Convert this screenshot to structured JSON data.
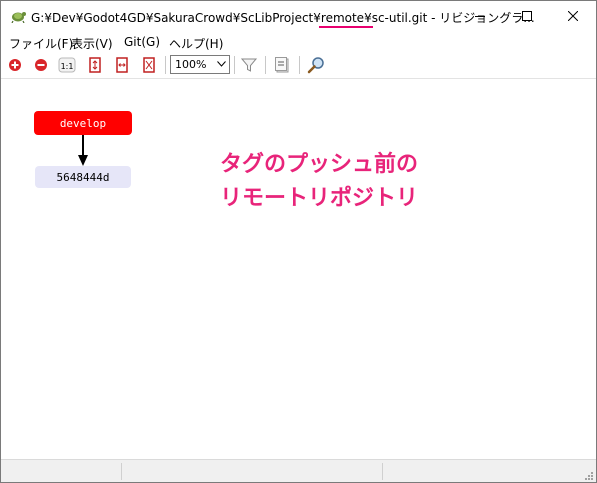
{
  "window": {
    "title": "G:¥Dev¥Godot4GD¥SakuraCrowd¥ScLibProject¥remote¥sc-util.git - リビジョングラ..."
  },
  "titlebar_buttons": {
    "minimize_icon": "minimize-icon",
    "maximize_icon": "maximize-icon",
    "close_icon": "close-icon"
  },
  "menu": [
    "ファイル(F)",
    "表示(V)",
    "Git(G)",
    "ヘルプ(H)"
  ],
  "toolbar": {
    "zoom_value": "100%",
    "icons": [
      "expand-all-icon",
      "collapse-all-icon",
      "actual-size-icon",
      "fit-icon",
      "fit-width-icon",
      "fit-height-icon",
      "filter-icon",
      "document-icon",
      "search-icon"
    ],
    "actual_size_label": "1:1"
  },
  "graph": {
    "branch_label": "develop",
    "commit_hash": "5648444d",
    "branch_color": "#ff0000",
    "commit_color": "#e6e6f8"
  },
  "annotation": {
    "line1": "タグのプッシュ前の",
    "line2": "リモートリポジトリ",
    "color": "#e8247a"
  }
}
